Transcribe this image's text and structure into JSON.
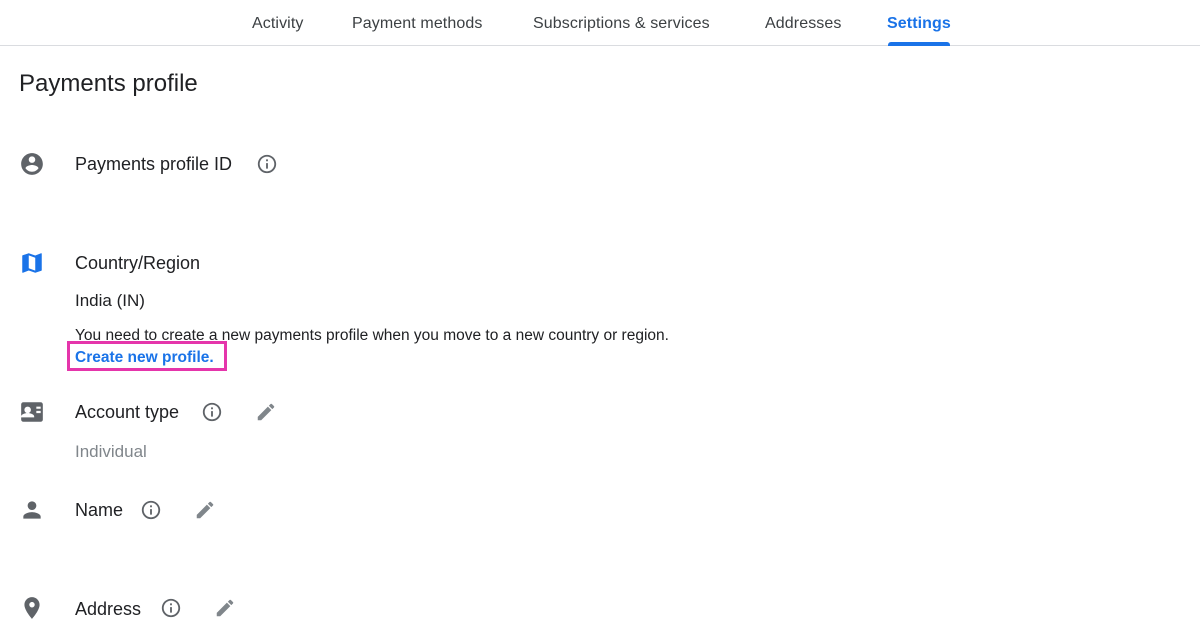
{
  "nav": {
    "tabs": [
      {
        "label": "Activity"
      },
      {
        "label": "Payment methods"
      },
      {
        "label": "Subscriptions & services"
      },
      {
        "label": "Addresses"
      },
      {
        "label": "Settings"
      }
    ],
    "active_tab": "Settings"
  },
  "page": {
    "title": "Payments profile"
  },
  "profile_id": {
    "label": "Payments profile ID",
    "icon": "account-circle-icon"
  },
  "country": {
    "label": "Country/Region",
    "icon": "map-icon",
    "value": "India (IN)",
    "note": "You need to create a new payments profile when you move to a new country or region.",
    "link_label": "Create new profile."
  },
  "account_type": {
    "label": "Account type",
    "icon": "id-card-icon",
    "value": "Individual"
  },
  "name": {
    "label": "Name",
    "icon": "person-icon"
  },
  "address": {
    "label": "Address",
    "icon": "location-pin-icon"
  },
  "colors": {
    "accent": "#1a73e8",
    "highlight": "#e535ab",
    "icon_gray": "#5f6368",
    "muted_text": "#80868b"
  }
}
